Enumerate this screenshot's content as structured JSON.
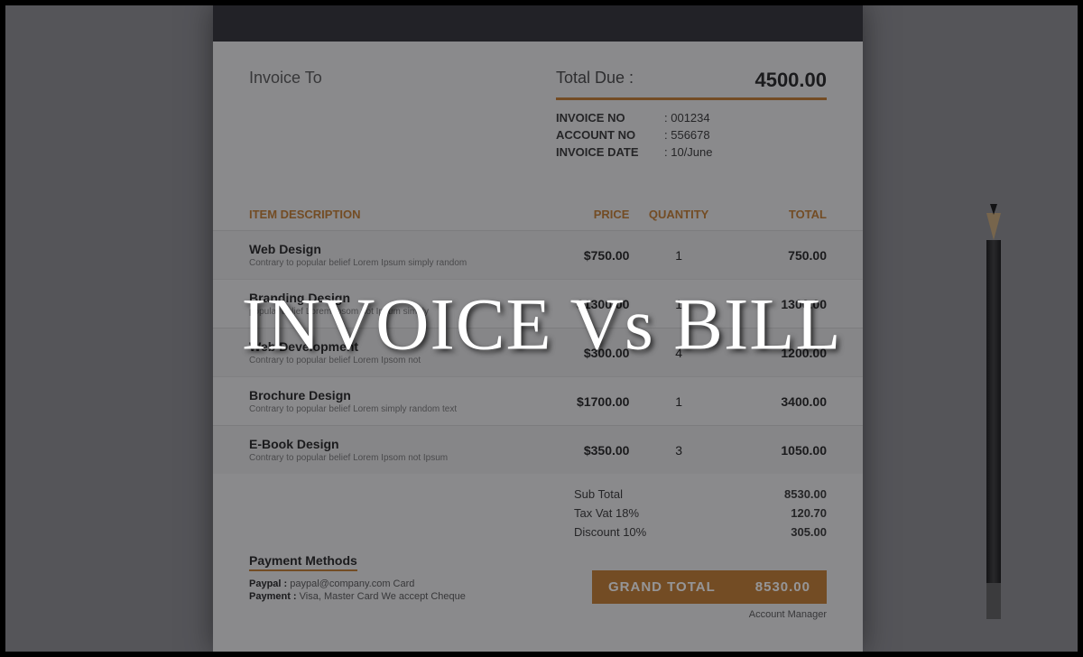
{
  "headline": "INVOICE Vs BILL",
  "invoice": {
    "to_label": "Invoice To",
    "total_due_label": "Total Due :",
    "total_due_value": "4500.00",
    "meta": [
      {
        "key": "INVOICE NO",
        "value": "001234"
      },
      {
        "key": "ACCOUNT NO",
        "value": "556678"
      },
      {
        "key": "INVOICE DATE",
        "value": "10/June"
      }
    ],
    "columns": {
      "desc": "ITEM DESCRIPTION",
      "price": "PRICE",
      "qty": "QUANTITY",
      "total": "TOTAL"
    },
    "items": [
      {
        "title": "Web Design",
        "sub": "Contrary to popular belief Lorem Ipsum simply random",
        "price": "$750.00",
        "qty": "1",
        "total": "750.00"
      },
      {
        "title": "Branding Design",
        "sub": "popular belief Lorem Ipsom not Ipsum simply",
        "price": "$1300.00",
        "qty": "1",
        "total": "1300.00"
      },
      {
        "title": "Web Development",
        "sub": "Contrary to popular belief Lorem Ipsom not",
        "price": "$300.00",
        "qty": "4",
        "total": "1200.00"
      },
      {
        "title": "Brochure Design",
        "sub": "Contrary to popular belief Lorem simply random text",
        "price": "$1700.00",
        "qty": "1",
        "total": "3400.00"
      },
      {
        "title": "E-Book Design",
        "sub": "Contrary to popular belief Lorem Ipsom not Ipsum",
        "price": "$350.00",
        "qty": "3",
        "total": "1050.00"
      }
    ],
    "summary": [
      {
        "label": "Sub Total",
        "value": "8530.00"
      },
      {
        "label": "Tax Vat 18%",
        "value": "120.70"
      },
      {
        "label": "Discount 10%",
        "value": "305.00"
      }
    ],
    "payment_title": "Payment Methods",
    "payment_lines": [
      {
        "k": "Paypal :",
        "v": "paypal@company.com Card"
      },
      {
        "k": "Payment :",
        "v": "Visa, Master Card We accept Cheque"
      }
    ],
    "grand_label": "GRAND  TOTAL",
    "grand_value": "8530.00",
    "acct_mgr": "Account Manager"
  }
}
